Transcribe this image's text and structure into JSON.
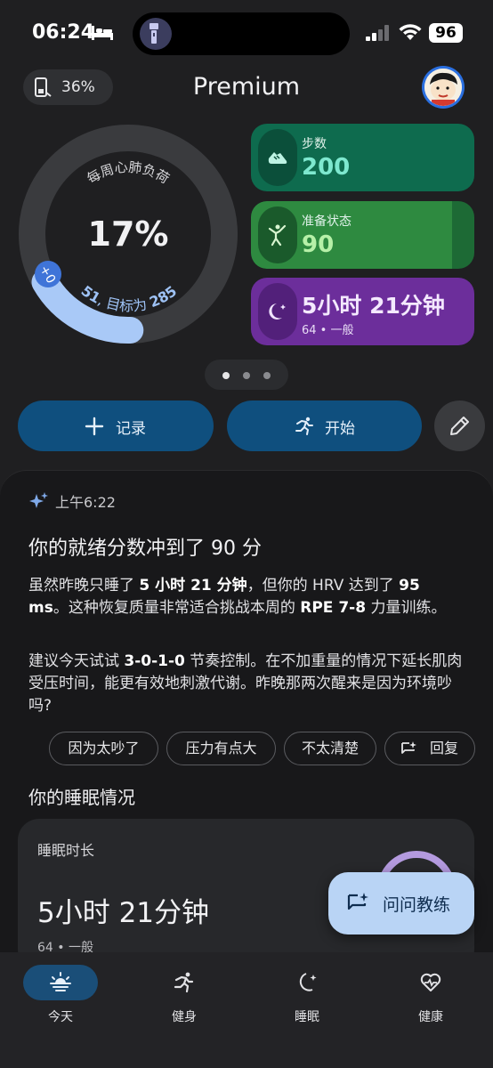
{
  "status_bar": {
    "time": "06:24",
    "battery": "96",
    "icons": [
      "bed-icon",
      "flashlight-icon",
      "signal-icon",
      "wifi-icon"
    ]
  },
  "header": {
    "phone_battery": "36%",
    "title": "Premium"
  },
  "cardio_ring": {
    "title": "每周心肺负荷",
    "percent_text": "17%",
    "percent": 17,
    "current": "51",
    "target_text": "目标为",
    "target": "285",
    "badge": "+0",
    "colors": {
      "track": "#3a3b3e",
      "progress": "#a9c9f7",
      "badge": "#3f74d8"
    }
  },
  "cards": {
    "steps": {
      "label": "步数",
      "value": "200",
      "icon": "shoe-icon",
      "color": "#0e6b4e"
    },
    "readiness": {
      "label": "准备状态",
      "value": "90",
      "icon": "person-stretch-icon",
      "color": "#1d6a35",
      "fill_fraction": 0.9
    },
    "sleep": {
      "value": "5小时 21分钟",
      "sub": "64 • 一般",
      "icon": "moon-icon",
      "color": "#6c2e9b"
    }
  },
  "actions": {
    "record": "记录",
    "start": "开始",
    "edit_icon": "pencil-icon"
  },
  "coach": {
    "time": "上午6:22",
    "title": "你的就绪分数冲到了 90 分",
    "p1": {
      "a": "虽然昨晚只睡了 ",
      "b": "5 小时 21 分钟",
      "c": "，但你的 HRV 达到了 ",
      "d": "95 ms",
      "e": "。这种恢复质量非常适合挑战本周的 ",
      "f": "RPE 7-8",
      "g": " 力量训练。"
    },
    "p2": {
      "a": "建议今天试试 ",
      "b": "3-0-1-0",
      "c": " 节奏控制。在不加重量的情况下延长肌肉受压时间，能更有效地刺激代谢。昨晚那两次醒来是因为环境吵吗?"
    },
    "replies": [
      "因为太吵了",
      "压力有点大",
      "不太清楚"
    ],
    "reply_button": "回复"
  },
  "sleep_section": {
    "title": "你的睡眠情况",
    "card_label": "睡眠时长",
    "value": "5小时 21分钟",
    "sub": "64 • 一般"
  },
  "ask_coach": "问问教练",
  "nav": [
    {
      "label": "今天",
      "icon": "sunrise-icon",
      "active": true
    },
    {
      "label": "健身",
      "icon": "running-icon",
      "active": false
    },
    {
      "label": "睡眠",
      "icon": "moon-icon",
      "active": false
    },
    {
      "label": "健康",
      "icon": "heart-icon",
      "active": false
    }
  ]
}
